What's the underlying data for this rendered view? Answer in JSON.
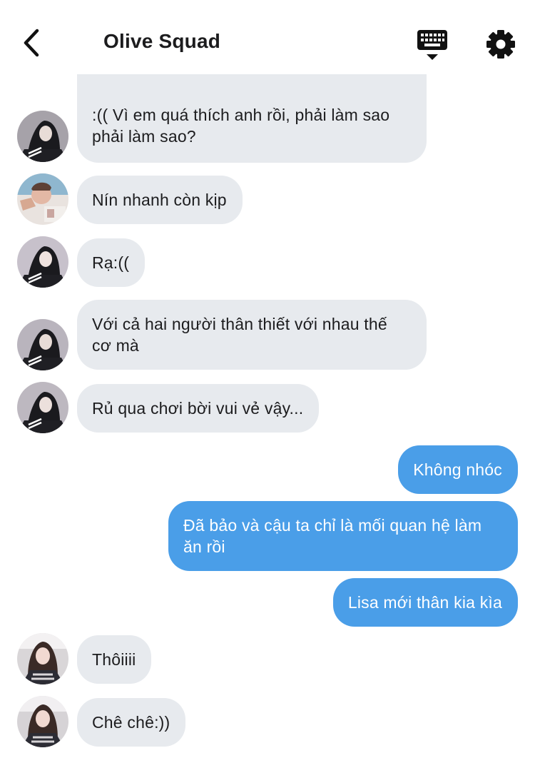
{
  "header": {
    "title": "Olive Squad",
    "back_icon": "chevron-left-icon",
    "keyboard_icon": "keyboard-hide-icon",
    "settings_icon": "gear-icon"
  },
  "colors": {
    "incoming_bubble": "#e7eaee",
    "outgoing_bubble": "#4a9ee8",
    "text_dark": "#1c1c1e"
  },
  "messages": [
    {
      "side": "in",
      "text": ":(( Vì em quá thích anh rồi, phải làm sao phải làm sao?"
    },
    {
      "side": "in",
      "text": "Nín nhanh còn kịp"
    },
    {
      "side": "in",
      "text": "Rạ:(("
    },
    {
      "side": "in",
      "text": "Với cả hai người thân thiết với nhau thế cơ mà"
    },
    {
      "side": "in",
      "text": "Rủ qua chơi bời vui vẻ vậy..."
    },
    {
      "side": "out",
      "text": "Không nhóc"
    },
    {
      "side": "out",
      "text": "Đã bảo và cậu ta chỉ là mối quan hệ làm ăn rồi"
    },
    {
      "side": "out",
      "text": "Lisa mới thân kia kìa"
    },
    {
      "side": "in",
      "text": "Thôiiii"
    },
    {
      "side": "in",
      "text": "Chê chê:))"
    }
  ]
}
